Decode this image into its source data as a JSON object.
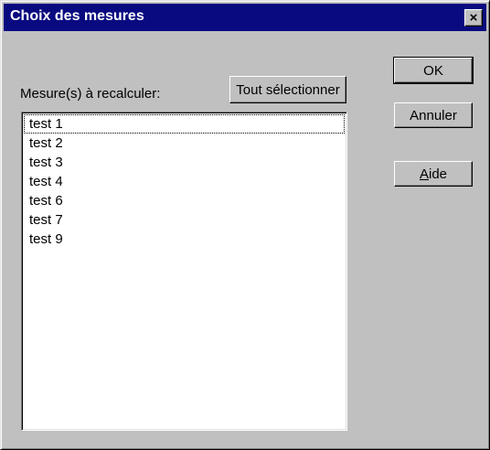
{
  "window": {
    "title": "Choix des mesures",
    "close_glyph": "×"
  },
  "buttons": {
    "select_all": "Tout sélectionner",
    "ok": "OK",
    "cancel": "Annuler",
    "help_mnemonic": "A",
    "help_rest": "ide"
  },
  "list": {
    "label": "Mesure(s) à recalculer:",
    "items": [
      "test 1",
      "test 2",
      "test 3",
      "test 4",
      "test 6",
      "test 7",
      "test 9"
    ]
  },
  "colors": {
    "titlebar": "#0a0a80",
    "face": "#c0c0c0"
  }
}
